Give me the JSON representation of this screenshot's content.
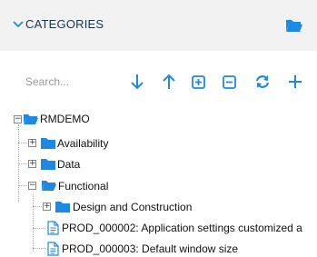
{
  "header": {
    "title": "CATEGORIES",
    "chevron_icon": "chevron-down-icon",
    "folder_icon": "folder-open-icon",
    "accent_color": "#1e88e5"
  },
  "toolbar": {
    "search_placeholder": "Search...",
    "buttons": [
      {
        "name": "sort-down",
        "icon": "arrow-down-icon"
      },
      {
        "name": "sort-up",
        "icon": "arrow-up-icon"
      },
      {
        "name": "expand-all",
        "icon": "plus-square-icon"
      },
      {
        "name": "collapse-all",
        "icon": "minus-square-icon"
      },
      {
        "name": "refresh",
        "icon": "refresh-icon"
      },
      {
        "name": "add",
        "icon": "plus-icon"
      }
    ]
  },
  "tree": {
    "root": {
      "label": "RMDEMO",
      "state": "expanded"
    },
    "items": [
      {
        "label": "Availability",
        "state": "collapsed",
        "type": "folder"
      },
      {
        "label": "Data",
        "state": "collapsed",
        "type": "folder"
      },
      {
        "label": "Functional",
        "state": "expanded",
        "type": "folder"
      },
      {
        "label": "Design and Construction",
        "state": "collapsed",
        "type": "folder"
      },
      {
        "label": "PROD_000002: Application settings customized a",
        "type": "document"
      },
      {
        "label": "PROD_000003: Default window size",
        "type": "document"
      }
    ]
  }
}
